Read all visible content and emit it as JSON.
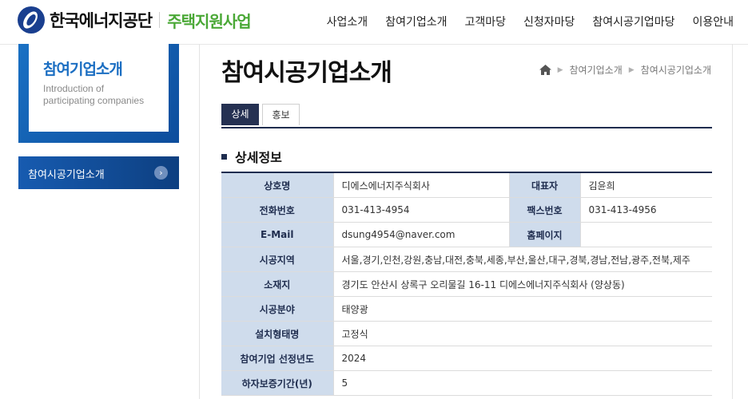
{
  "header": {
    "logo_name": "한국에너지공단",
    "logo_sub": "주택지원사업",
    "nav": [
      "사업소개",
      "참여기업소개",
      "고객마당",
      "신청자마당",
      "참여시공기업마당",
      "이용안내"
    ]
  },
  "sidebar": {
    "title": "참여기업소개",
    "subtitle_en": "Introduction of participating companies",
    "menu_item": "참여시공기업소개",
    "menu_arrow": "›"
  },
  "main": {
    "title": "참여시공기업소개",
    "breadcrumb": [
      "참여기업소개",
      "참여시공기업소개"
    ],
    "tabs": [
      "상세",
      "홍보"
    ],
    "section_title": "상세정보"
  },
  "details": {
    "company_label": "상호명",
    "company": "디에스에너지주식회사",
    "ceo_label": "대표자",
    "ceo": "김윤희",
    "phone_label": "전화번호",
    "phone": "031-413-4954",
    "fax_label": "팩스번호",
    "fax": "031-413-4956",
    "email_label": "E-Mail",
    "email": "dsung4954@naver.com",
    "homepage_label": "홈페이지",
    "homepage": "",
    "region_label": "시공지역",
    "region": "서울,경기,인천,강원,충남,대전,충북,세종,부산,울산,대구,경북,경남,전남,광주,전북,제주",
    "address_label": "소재지",
    "address": "경기도 안산시 상록구 오리물길 16-11 디에스에너지주식회사 (양상동)",
    "field_label": "시공분야",
    "field": "태양광",
    "install_type_label": "설치형태명",
    "install_type": "고정식",
    "year_label": "참여기업 선정년도",
    "year": "2024",
    "warranty_label": "하자보증기간(년)",
    "warranty": "5"
  },
  "colors": {
    "brand_blue": "#1b6ec2",
    "brand_green": "#4aa836",
    "navy": "#1f2d4f",
    "table_header": "#cfdcec"
  }
}
